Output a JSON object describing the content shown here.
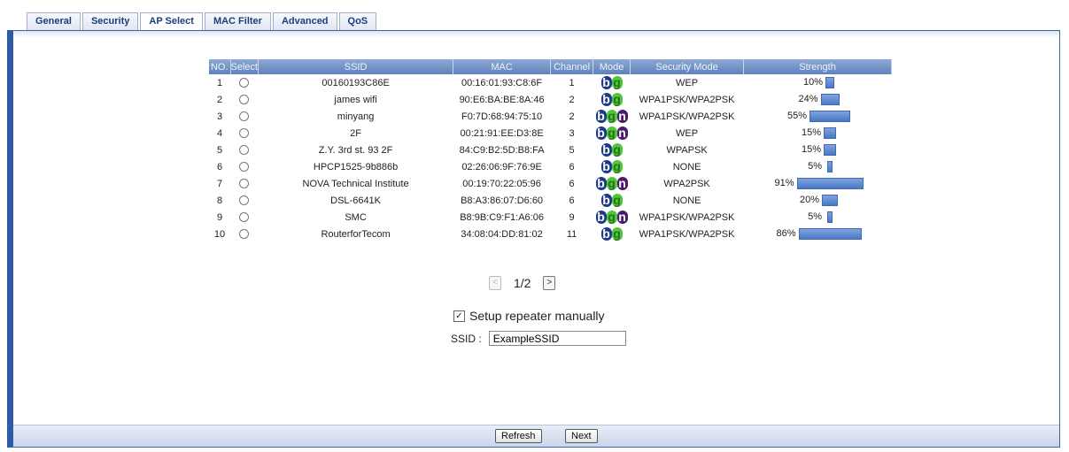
{
  "tabs": [
    "General",
    "Security",
    "AP Select",
    "MAC Filter",
    "Advanced",
    "QoS"
  ],
  "active_tab": "AP Select",
  "table": {
    "headers": [
      "NO.",
      "Select",
      "SSID",
      "MAC",
      "Channel",
      "Mode",
      "Security Mode",
      "Strength"
    ],
    "rows": [
      {
        "no": "1",
        "ssid": "00160193C86E",
        "mac": "00:16:01:93:C8:6F",
        "channel": "1",
        "mode": [
          "b",
          "g"
        ],
        "security": "WEP",
        "strength": "10%",
        "strength_value": 10
      },
      {
        "no": "2",
        "ssid": "james wifi",
        "mac": "90:E6:BA:BE:8A:46",
        "channel": "2",
        "mode": [
          "b",
          "g"
        ],
        "security": "WPA1PSK/WPA2PSK",
        "strength": "24%",
        "strength_value": 24
      },
      {
        "no": "3",
        "ssid": "minyang",
        "mac": "F0:7D:68:94:75:10",
        "channel": "2",
        "mode": [
          "b",
          "g",
          "n"
        ],
        "security": "WPA1PSK/WPA2PSK",
        "strength": "55%",
        "strength_value": 55
      },
      {
        "no": "4",
        "ssid": "2F",
        "mac": "00:21:91:EE:D3:8E",
        "channel": "3",
        "mode": [
          "b",
          "g",
          "n"
        ],
        "security": "WEP",
        "strength": "15%",
        "strength_value": 15
      },
      {
        "no": "5",
        "ssid": "Z.Y. 3rd st. 93 2F",
        "mac": "84:C9:B2:5D:B8:FA",
        "channel": "5",
        "mode": [
          "b",
          "g"
        ],
        "security": "WPAPSK",
        "strength": "15%",
        "strength_value": 15
      },
      {
        "no": "6",
        "ssid": "HPCP1525-9b886b",
        "mac": "02:26:06:9F:76:9E",
        "channel": "6",
        "mode": [
          "b",
          "g"
        ],
        "security": "NONE",
        "strength": "5%",
        "strength_value": 5
      },
      {
        "no": "7",
        "ssid": "NOVA Technical Institute",
        "mac": "00:19:70:22:05:96",
        "channel": "6",
        "mode": [
          "b",
          "g",
          "n"
        ],
        "security": "WPA2PSK",
        "strength": "91%",
        "strength_value": 91
      },
      {
        "no": "8",
        "ssid": "DSL-6641K",
        "mac": "B8:A3:86:07:D6:60",
        "channel": "6",
        "mode": [
          "b",
          "g"
        ],
        "security": "NONE",
        "strength": "20%",
        "strength_value": 20
      },
      {
        "no": "9",
        "ssid": "SMC",
        "mac": "B8:9B:C9:F1:A6:06",
        "channel": "9",
        "mode": [
          "b",
          "g",
          "n"
        ],
        "security": "WPA1PSK/WPA2PSK",
        "strength": "5%",
        "strength_value": 5
      },
      {
        "no": "10",
        "ssid": "RouterforTecom",
        "mac": "34:08:04:DD:81:02",
        "channel": "11",
        "mode": [
          "b",
          "g"
        ],
        "security": "WPA1PSK/WPA2PSK",
        "strength": "86%",
        "strength_value": 86
      }
    ]
  },
  "pager": {
    "prev": "<",
    "next": ">",
    "page": "1/2"
  },
  "repeater": {
    "checked": true,
    "label": "Setup repeater manually"
  },
  "ssid_field": {
    "label": "SSID :",
    "value": "ExampleSSID"
  },
  "buttons": {
    "refresh": "Refresh",
    "next": "Next"
  },
  "icons": {
    "checkbox": "checkbox-checked-icon",
    "radio": "radio-icon"
  }
}
